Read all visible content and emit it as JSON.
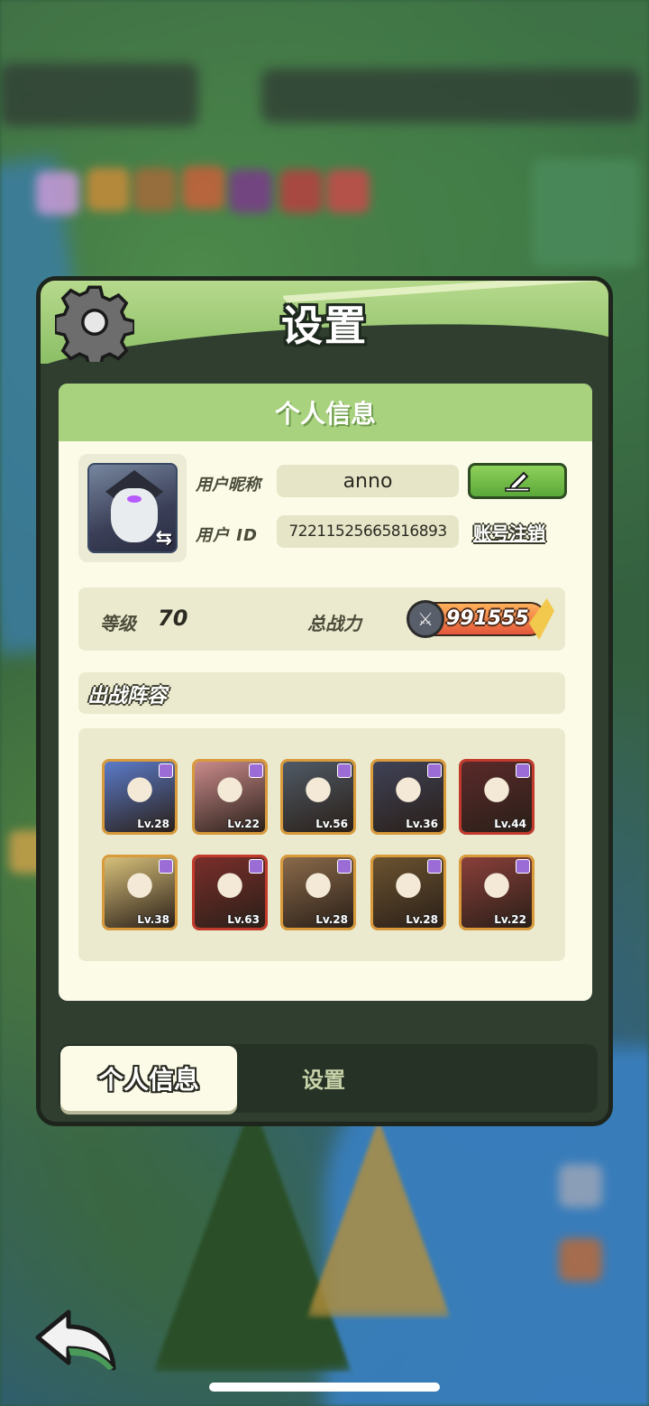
{
  "header": {
    "title": "设置"
  },
  "card": {
    "title": "个人信息",
    "nickname_label": "用户昵称",
    "nickname_value": "anno",
    "id_label": "用户 ID",
    "id_value": "72211525665816893",
    "cancel_account": "账号注销",
    "level_label": "等级",
    "level_value": "70",
    "power_label": "总战力",
    "power_value": "991555",
    "lineup_title": "出战阵容"
  },
  "heroes": [
    {
      "level": "Lv.28",
      "frame": "gold",
      "art": "#5b7bc9"
    },
    {
      "level": "Lv.22",
      "frame": "gold",
      "art": "#c98b8b"
    },
    {
      "level": "Lv.56",
      "frame": "gold",
      "art": "#4f5a66"
    },
    {
      "level": "Lv.36",
      "frame": "gold",
      "art": "#3f4257"
    },
    {
      "level": "Lv.44",
      "frame": "red",
      "art": "#5a2a2a"
    },
    {
      "level": "Lv.38",
      "frame": "gold",
      "art": "#d7c07a"
    },
    {
      "level": "Lv.63",
      "frame": "red",
      "art": "#7a2e2a"
    },
    {
      "level": "Lv.28",
      "frame": "gold",
      "art": "#8a6a4a"
    },
    {
      "level": "Lv.28",
      "frame": "gold",
      "art": "#6b5330"
    },
    {
      "level": "Lv.22",
      "frame": "gold",
      "art": "#8a3f3a"
    }
  ],
  "tabs": {
    "active": "个人信息",
    "inactive": "设置"
  },
  "icons": [
    "gear-icon",
    "pencil-icon",
    "swap-icon",
    "sword-icon",
    "back-arrow-icon"
  ]
}
